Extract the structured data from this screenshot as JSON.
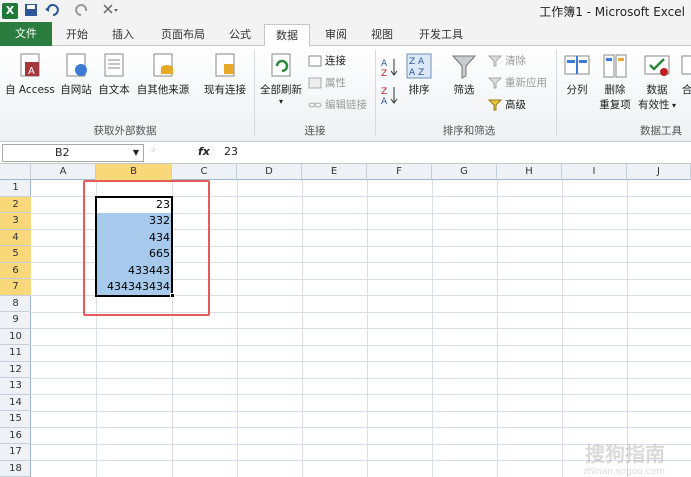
{
  "titlebar": {
    "app_title": "工作簿1 - Microsoft Excel",
    "quick_access": [
      "save-icon",
      "undo-icon",
      "redo-icon",
      "customize-icon"
    ]
  },
  "tabs": [
    {
      "label": "文件"
    },
    {
      "label": "开始"
    },
    {
      "label": "插入"
    },
    {
      "label": "页面布局"
    },
    {
      "label": "公式"
    },
    {
      "label": "数据",
      "active": true
    },
    {
      "label": "审阅"
    },
    {
      "label": "视图"
    },
    {
      "label": "开发工具"
    }
  ],
  "ribbon": {
    "external": {
      "from_access": "自 Access",
      "from_web": "自网站",
      "from_text": "自文本",
      "from_other": "自其他来源",
      "existing": "现有连接",
      "group_label": "获取外部数据"
    },
    "connections": {
      "refresh_all": "全部刷新",
      "connections": "连接",
      "properties": "属性",
      "edit_links": "编辑链接",
      "group_label": "连接"
    },
    "sort_filter": {
      "sort": "排序",
      "filter": "筛选",
      "clear": "清除",
      "reapply": "重新应用",
      "advanced": "高级",
      "group_label": "排序和筛选"
    },
    "data_tools": {
      "split": "分列",
      "remove_dup_1": "删除",
      "remove_dup_2": "重复项",
      "validation_1": "数据",
      "validation_2": "有效性",
      "consolidate": "合",
      "group_label": "数据工具"
    }
  },
  "formula_bar": {
    "name_box": "B2",
    "fx": "fx",
    "value": "23"
  },
  "grid": {
    "columns": [
      "A",
      "B",
      "C",
      "D",
      "E",
      "F",
      "G",
      "H",
      "I",
      "J"
    ],
    "rows": [
      "1",
      "2",
      "3",
      "4",
      "5",
      "6",
      "7",
      "8",
      "9",
      "10",
      "11",
      "12",
      "13",
      "14",
      "15",
      "16",
      "17",
      "18"
    ],
    "selected_column": "B",
    "selected_rows": [
      "2",
      "3",
      "4",
      "5",
      "6",
      "7"
    ],
    "b_values": [
      "23",
      "332",
      "434",
      "665",
      "433443",
      "434343434"
    ]
  },
  "colors": {
    "selection_fill": "#a6c9ec",
    "header_highlight": "#f8d878",
    "annotation_red": "#e35b5b",
    "file_tab": "#2a7d3e"
  },
  "watermark": {
    "text": "搜狗指南",
    "url": "zhinan.sogou.com"
  }
}
